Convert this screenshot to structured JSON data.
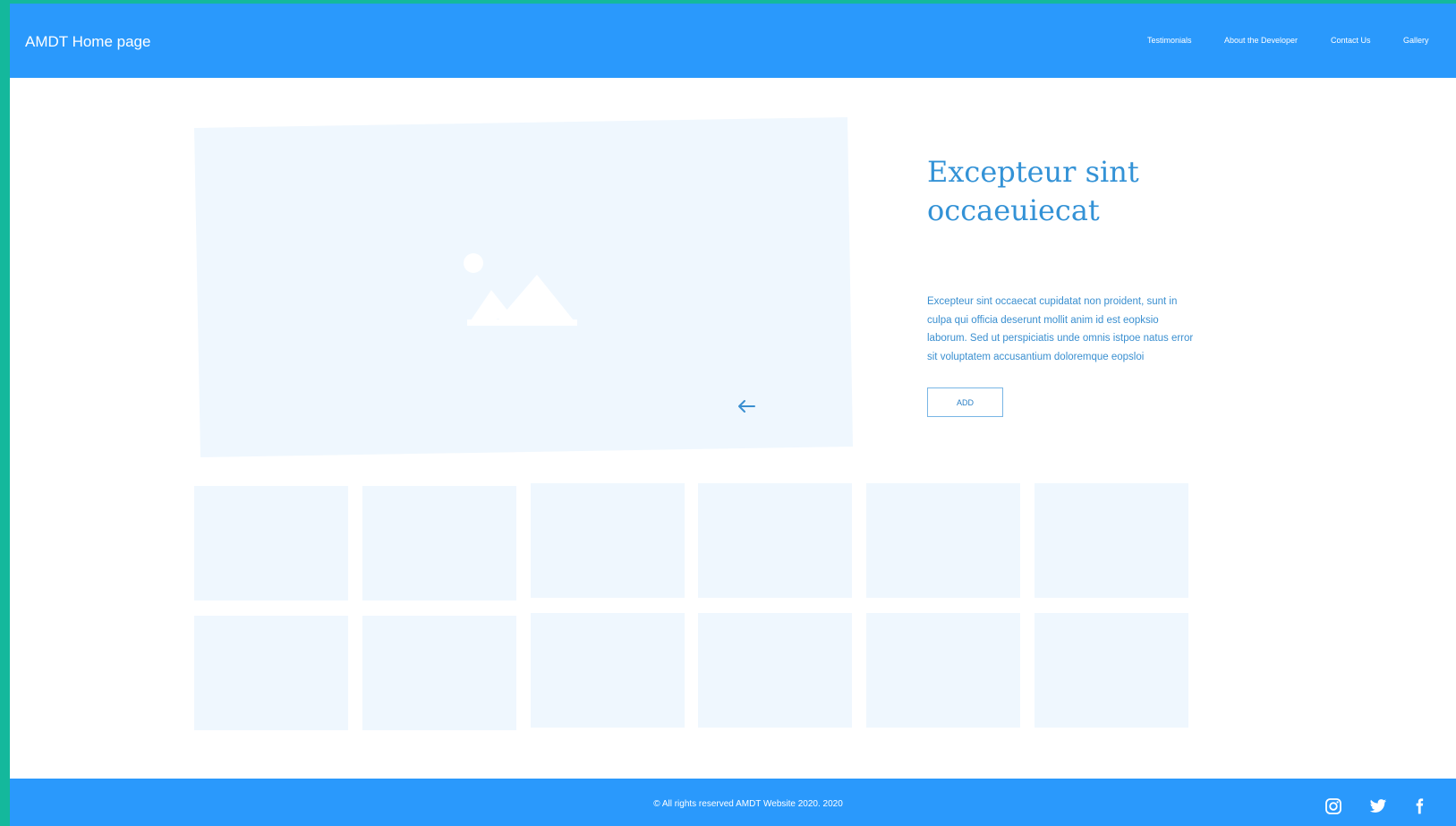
{
  "header": {
    "brand": "AMDT Home page",
    "nav": [
      "Testimonials",
      "About the Developer",
      "Contact Us",
      "Gallery"
    ]
  },
  "hero": {
    "title": "Excepteur sint occaeuiecat",
    "description": "Excepteur sint occaecat cupidatat non proident, sunt in culpa qui officia deserunt mollit anim id est eopksio laborum. Sed ut perspiciatis unde omnis istpoe natus error sit voluptatem accusantium doloremque eopsloi",
    "button_label": "ADD",
    "image_icon": "image-placeholder-icon",
    "arrow_icon": "arrow-left-icon"
  },
  "footer": {
    "copyright": "© All rights reserved AMDT Website 2020. 2020",
    "social": [
      "instagram-icon",
      "twitter-icon",
      "facebook-icon"
    ]
  },
  "colors": {
    "accent": "#2a99fc",
    "frame": "#14b89c",
    "placeholder": "#eff7fe",
    "heading": "#3392d6"
  }
}
